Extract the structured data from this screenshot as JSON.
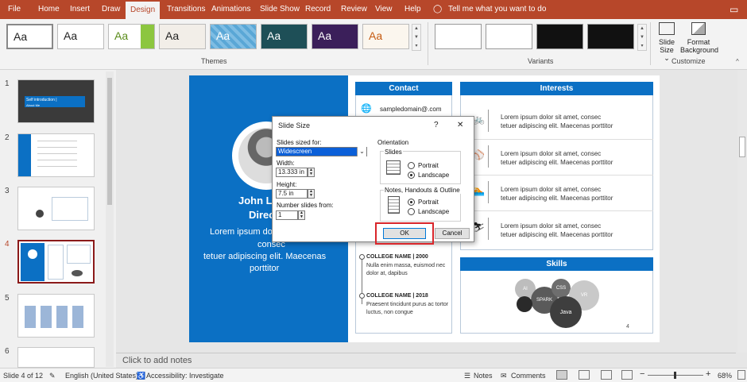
{
  "ribbon_tabs": [
    "File",
    "Home",
    "Insert",
    "Draw",
    "Design",
    "Transitions",
    "Animations",
    "Slide Show",
    "Record",
    "Review",
    "View",
    "Help"
  ],
  "active_tab": "Design",
  "tell_me": "Tell me what you want to do",
  "themes_label": "Themes",
  "variants_label": "Variants",
  "customize_label": "Customize",
  "theme_sample": "Aa",
  "customize": {
    "slide_size": "Slide Size",
    "slide_size_caret": "⌄",
    "format_background": "Format Background"
  },
  "thumb_numbers": [
    "1",
    "2",
    "3",
    "4",
    "5",
    "6"
  ],
  "thumb1_title": "Self introduction |",
  "thumb1_sub": "About Me",
  "slide": {
    "name": "John Li",
    "role": "Direc",
    "bio_lines": [
      "Lorem ipsum do",
      "consec",
      "tetuer adipiscing elit. Maecenas",
      "porttitor"
    ],
    "contact_title": "Contact",
    "contact_email": "sampledomain@.com",
    "interests_title": "Interests",
    "interest_text": [
      "Lorem ipsum dolor sit amet, consec",
      "tetuer adipiscing elit. Maecenas porttitor"
    ],
    "skills_title": "Skills",
    "skills": [
      "AI",
      "SPARK",
      "CSS",
      "VR",
      "Java"
    ],
    "college1": "COLLEGE NAME | 2000",
    "college1_text": [
      "Nulla enim massa, euismod nec",
      "dolor at, dapibus"
    ],
    "college2": "COLLEGE NAME | 2018",
    "college2_text": [
      "Praesent tincidunt purus ac tortor",
      "luctus, non congue"
    ],
    "page_number": "4"
  },
  "dialog": {
    "title": "Slide Size",
    "help": "?",
    "close": "✕",
    "slides_sized_for_label": "Slides sized for:",
    "slides_sized_for_value": "Widescreen",
    "width_label": "Width:",
    "width_value": "13.333 in",
    "height_label": "Height:",
    "height_value": "7.5 in",
    "number_from_label": "Number slides from:",
    "number_from_value": "1",
    "orientation_label": "Orientation",
    "slides_group": "Slides",
    "portrait": "Portrait",
    "landscape": "Landscape",
    "notes_group": "Notes, Handouts & Outline",
    "notes_portrait": "Portrait",
    "notes_landscape": "Landscape",
    "ok": "OK",
    "cancel": "Cancel",
    "highlight_color": "#d9262b"
  },
  "notes_placeholder": "Click to add notes",
  "status": {
    "slide_of": "Slide 4 of 12",
    "language": "English (United States)",
    "accessibility": "Accessibility: Investigate",
    "notes": "Notes",
    "comments": "Comments",
    "zoom": "68%",
    "zoom_minus": "−",
    "zoom_plus": "+"
  },
  "colors": {
    "accent": "#b7472a",
    "slide_blue": "#0b70c4"
  }
}
